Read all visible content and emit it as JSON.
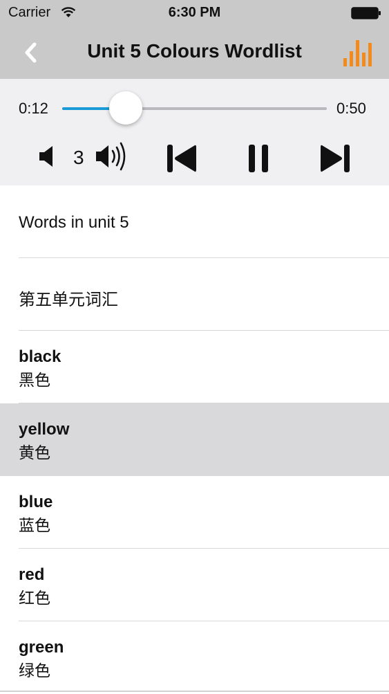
{
  "status_bar": {
    "carrier": "Carrier",
    "time": "6:30 PM"
  },
  "nav": {
    "title": "Unit 5 Colours Wordlist",
    "back_icon": "chevron-left-icon",
    "equalizer_icon": "equalizer-icon"
  },
  "player": {
    "current_time": "0:12",
    "duration": "0:50",
    "progress_fraction": 0.24,
    "volume_level": "3"
  },
  "list": {
    "header_en": "Words in unit 5",
    "header_zh": "第五单元词汇",
    "words": [
      {
        "en": "black",
        "zh": "黑色"
      },
      {
        "en": "yellow",
        "zh": "黄色"
      },
      {
        "en": "blue",
        "zh": "蓝色"
      },
      {
        "en": "red",
        "zh": "红色"
      },
      {
        "en": "green",
        "zh": "绿色"
      }
    ],
    "selected_index": 1
  },
  "colors": {
    "nav_bg": "#c9c9c9",
    "accent_orange": "#f28a1e",
    "slider_blue": "#1a9bd7",
    "selected_row": "#d9d9db"
  }
}
